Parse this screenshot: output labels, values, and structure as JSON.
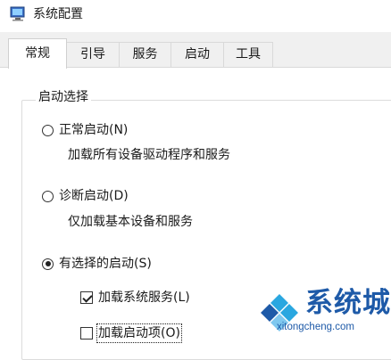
{
  "window": {
    "title": "系统配置"
  },
  "tabs": [
    {
      "label": "常规",
      "active": true
    },
    {
      "label": "引导",
      "active": false
    },
    {
      "label": "服务",
      "active": false
    },
    {
      "label": "启动",
      "active": false
    },
    {
      "label": "工具",
      "active": false
    }
  ],
  "startup_selection": {
    "group_label": "启动选择",
    "options": [
      {
        "label": "正常启动(N)",
        "description": "加载所有设备驱动程序和服务",
        "selected": false
      },
      {
        "label": "诊断启动(D)",
        "description": "仅加载基本设备和服务",
        "selected": false
      },
      {
        "label": "有选择的启动(S)",
        "selected": true
      }
    ],
    "checkboxes": [
      {
        "label": "加载系统服务(L)",
        "checked": true
      },
      {
        "label": "加载启动项(O)",
        "checked": false,
        "focused": true
      }
    ]
  },
  "watermark": {
    "name": "系统城",
    "url": "xitongcheng.com"
  },
  "colors": {
    "watermark_blue": "#1e5aa8",
    "window_bg": "#ffffff",
    "tab_bg": "#f0f0f0"
  }
}
